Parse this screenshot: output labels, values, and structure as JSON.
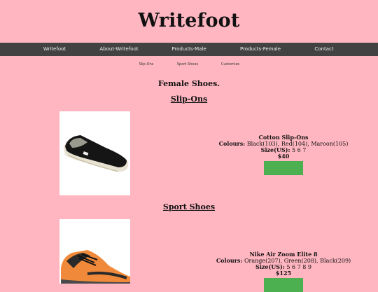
{
  "site": {
    "brand": "Writefoot"
  },
  "nav": {
    "items": [
      "Writefoot",
      "About-Writefoot",
      "Products-Male",
      "Products-Female",
      "Contact"
    ]
  },
  "subnav": {
    "items": [
      "Slip-Ons",
      "Sport-Shoes",
      "Customize"
    ]
  },
  "page": {
    "heading": "Female Shoes."
  },
  "sections": [
    {
      "heading": "Slip-Ons",
      "product": {
        "name": "Cotton Slip-Ons",
        "colours_label": "Colours:",
        "colours": "Black(103), Red(104), Maroon(105)",
        "size_label": "Size(US):",
        "sizes": "5 6 7",
        "price": "$40",
        "image_icon": "black-slip-on-shoe-image"
      }
    },
    {
      "heading": "Sport Shoes",
      "product": {
        "name": "Nike Air Zoom Elite 8",
        "colours_label": "Colours:",
        "colours": "Orange(207), Green(208), Black(209)",
        "size_label": "Size(US):",
        "sizes": "5 6 7 8 9",
        "price": "$125",
        "image_icon": "orange-running-shoe-image"
      }
    }
  ],
  "colors": {
    "background": "#ffb6c1",
    "navbar": "#424242",
    "button": "#4caf50"
  }
}
